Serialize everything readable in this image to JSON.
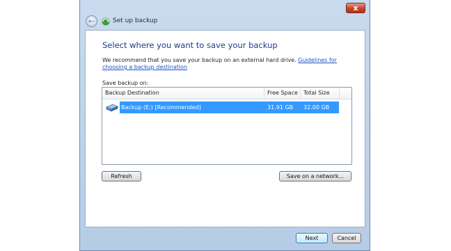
{
  "window": {
    "title": "Set up backup",
    "close_glyph": "x",
    "back_glyph": "←",
    "icons": [
      "back-arrow-icon",
      "backup-app-icon",
      "close-icon",
      "drive-icon"
    ]
  },
  "page": {
    "heading": "Select where you want to save your backup",
    "recommendation": "We recommend that you save your backup on an external hard drive.",
    "guidelines_link": "Guidelines for choosing a backup destination",
    "save_on_label": "Save backup on:"
  },
  "table": {
    "headers": [
      "Backup Destination",
      "Free Space",
      "Total Size"
    ],
    "rows": [
      {
        "destination": "Backup (E:) [Recommended]",
        "free_space": "31.91 GB",
        "total_size": "32.00 GB",
        "selected": true
      }
    ]
  },
  "buttons": {
    "refresh": "Refresh",
    "save_network": "Save on a network...",
    "next": "Next",
    "cancel": "Cancel"
  },
  "colors": {
    "selection": "#3399ff",
    "heading": "#1f3b8a",
    "link": "#1a52c4",
    "close_button": "#c7432a"
  }
}
